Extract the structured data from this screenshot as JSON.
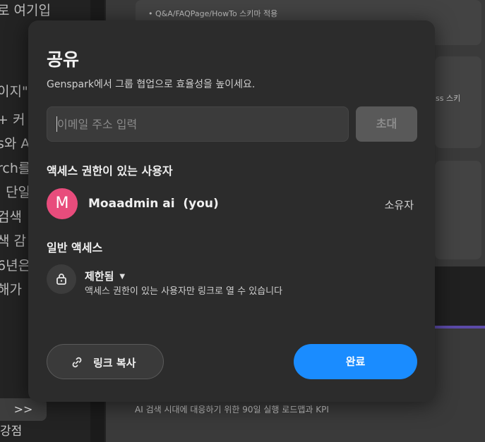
{
  "background": {
    "left_fragments": [
      "로 여기입",
      "이지\"",
      "+ 커",
      "s와 A",
      "rch를",
      "· 단일",
      "검색",
      "색 감",
      "6년은",
      "해가"
    ],
    "faq_line": "Q&A/FAQPage/HowTo 스키마 적용",
    "side_text": "ss 스키",
    "bottom_text": "AI 검색 시대에 대응하기 위한 90일 실행 로드맵과 KPI",
    "expand_label": ">>",
    "expand_text": "강점"
  },
  "modal": {
    "title": "공유",
    "subtitle": "Genspark에서 그룹 협업으로 효율성을 높이세요.",
    "email_placeholder": "이메일 주소 입력",
    "email_value": "",
    "invite_label": "초대",
    "users_heading": "액세스 권한이 있는 사용자",
    "users": [
      {
        "initial": "M",
        "name": "Moaadmin ai  (you)",
        "role": "소유자",
        "avatar_color": "#e84c7c"
      }
    ],
    "general_heading": "일반 액세스",
    "access_level": "제한됨",
    "access_chevron": "▼",
    "access_description": "액세스 권한이 있는 사용자만 링크로 열 수 있습니다",
    "copy_link_label": "링크 복사",
    "done_label": "완료"
  },
  "colors": {
    "accent": "#1a8cff",
    "modal_bg": "#2c2c2c",
    "avatar": "#e84c7c"
  },
  "icons": [
    "lock-icon",
    "link-icon",
    "chevron-down-icon"
  ]
}
